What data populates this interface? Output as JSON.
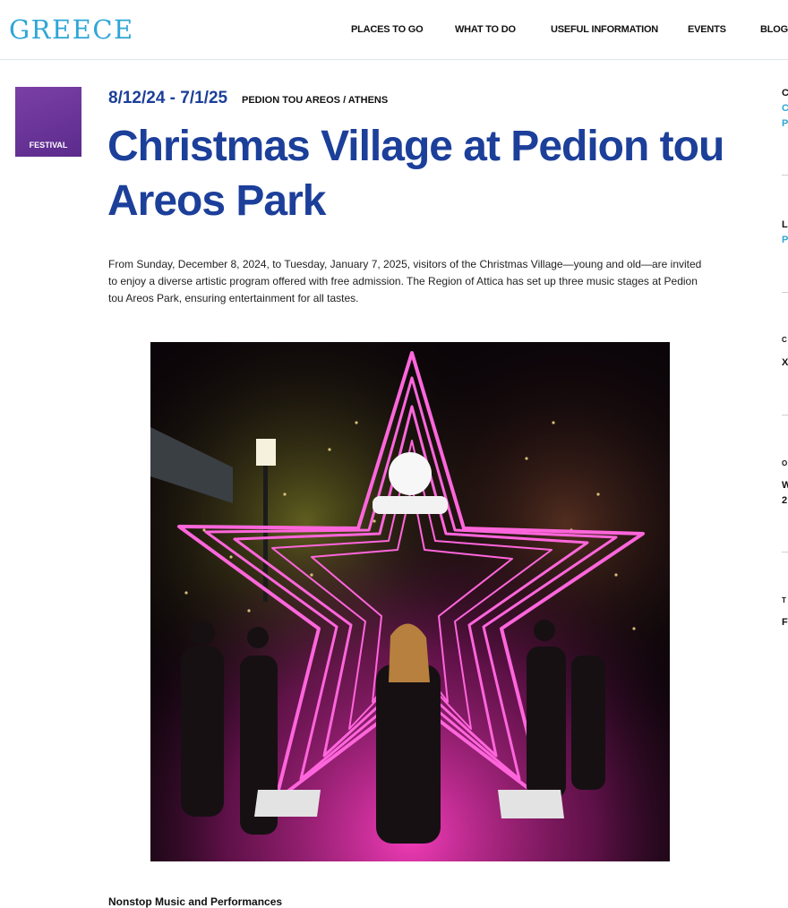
{
  "header": {
    "logo": "GREECE",
    "nav": [
      "PLACES TO GO",
      "WHAT TO DO",
      "USEFUL INFORMATION",
      "EVENTS",
      "BLOG"
    ]
  },
  "event": {
    "category": "FESTIVAL",
    "date": "8/12/24 - 7/1/25",
    "location": "PEDION TOU AREOS / ATHENS",
    "title": "Christmas Village at Pedion tou Areos Park",
    "intro": "From Sunday, December 8, 2024, to Tuesday, January 7, 2025, visitors of the Christmas Village—young and old—are invited to enjoy a diverse artistic program offered with free admission. The Region of Attica has set up three music stages at Pedion tou Areos Park, ensuring entertainment for all tastes.",
    "subheading": "Nonstop Music and Performances"
  },
  "sidebar": {
    "chars": [
      "C",
      "C",
      "P",
      "L",
      "P",
      "C",
      "X",
      "O",
      "W",
      "2",
      "T",
      "F"
    ]
  },
  "colors": {
    "brand_blue": "#1c3f9a",
    "logo_cyan": "#2fa6d6",
    "badge_purple": "#6a3199",
    "neon_pink": "#ff4fd0"
  }
}
